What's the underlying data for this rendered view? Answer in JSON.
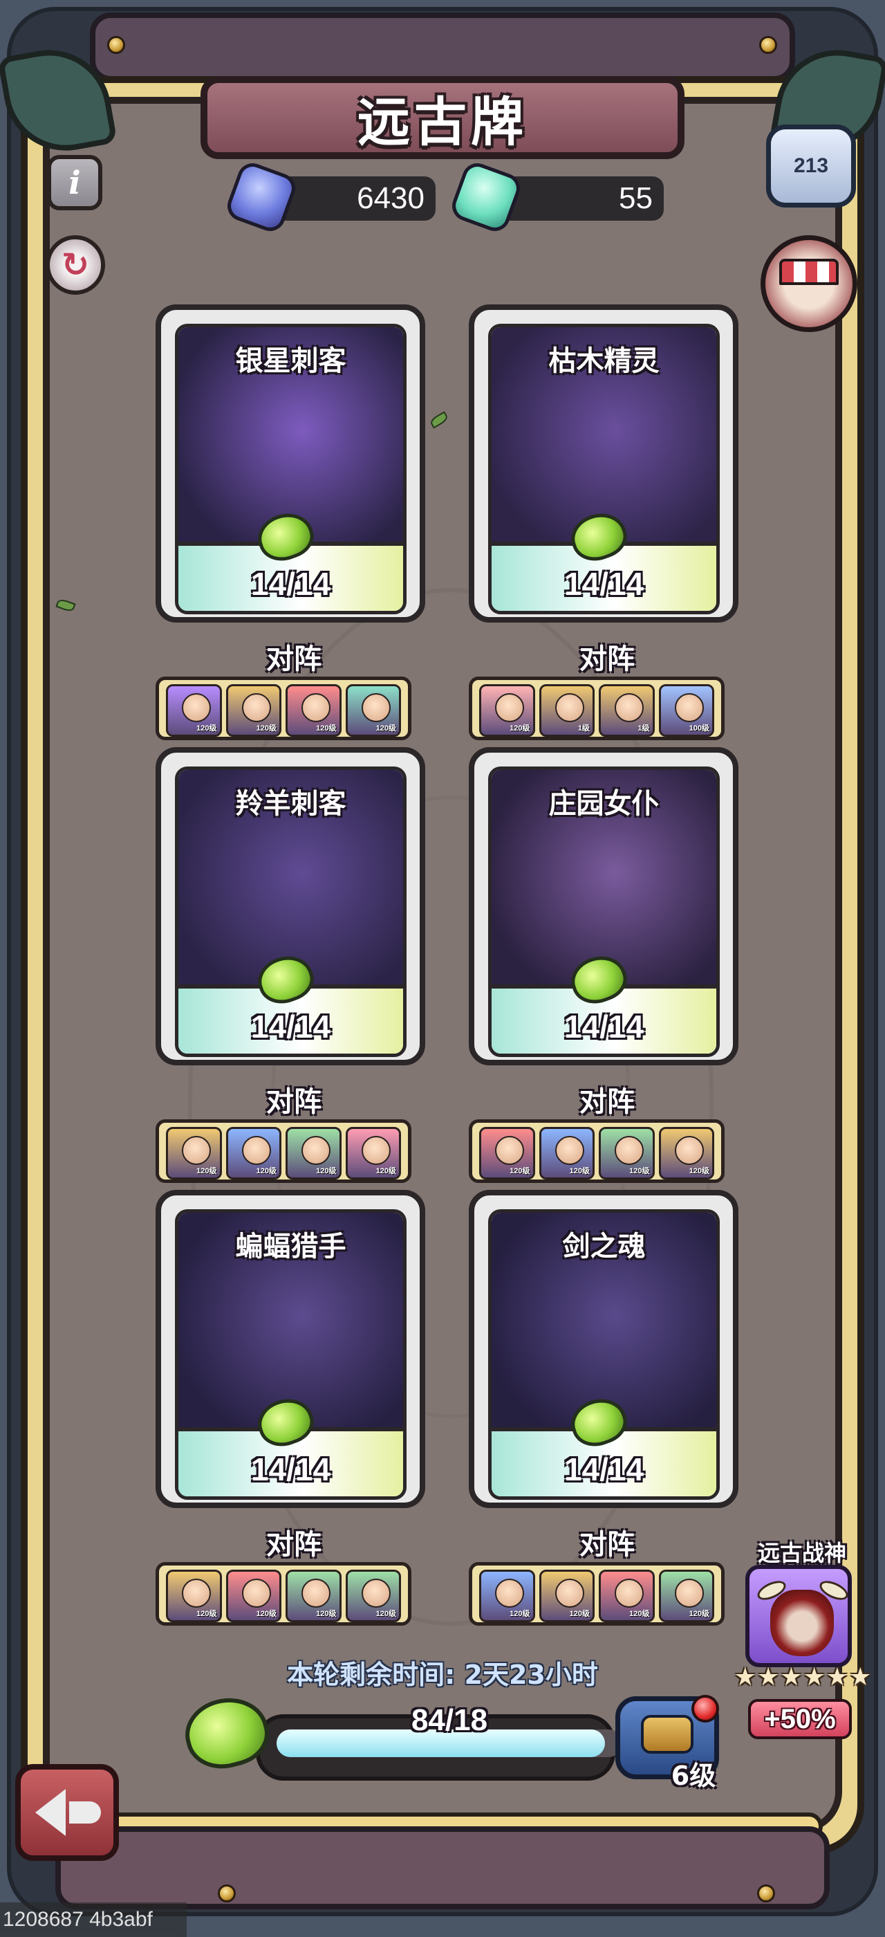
{
  "title": "远古牌",
  "currencies": {
    "blue": "6430",
    "green": "55"
  },
  "lineup_label": "对阵",
  "cards": [
    {
      "name": "银星刺客",
      "count": "14/14",
      "art_colors": [
        "#2a2346",
        "#7d5bbf"
      ],
      "lineup": [
        {
          "level": "120级",
          "color": "#b88dff"
        },
        {
          "level": "120级",
          "color": "#f0c971"
        },
        {
          "level": "120级",
          "color": "#ff8d8d"
        },
        {
          "level": "120级",
          "color": "#8de0c9"
        }
      ]
    },
    {
      "name": "枯木精灵",
      "count": "14/14",
      "art_colors": [
        "#2d2448",
        "#6a4f9e"
      ],
      "lineup": [
        {
          "level": "120级",
          "color": "#ffb4b4"
        },
        {
          "level": "1级",
          "color": "#f0c971"
        },
        {
          "level": "1级",
          "color": "#f0c971"
        },
        {
          "level": "100级",
          "color": "#a3c4ff"
        }
      ]
    },
    {
      "name": "羚羊刺客",
      "count": "14/14",
      "art_colors": [
        "#2c2448",
        "#5f4b94"
      ],
      "lineup": [
        {
          "level": "120级",
          "color": "#f0c971"
        },
        {
          "level": "120级",
          "color": "#8db6ff"
        },
        {
          "level": "120级",
          "color": "#9ee0a6"
        },
        {
          "level": "120级",
          "color": "#ff9db3"
        }
      ]
    },
    {
      "name": "庄园女仆",
      "count": "14/14",
      "art_colors": [
        "#2b2140",
        "#7a5b9d"
      ],
      "lineup": [
        {
          "level": "120级",
          "color": "#ff8d8d"
        },
        {
          "level": "120级",
          "color": "#8db6ff"
        },
        {
          "level": "120级",
          "color": "#9ee0a6"
        },
        {
          "level": "120级",
          "color": "#f0c971"
        }
      ]
    },
    {
      "name": "蝙蝠猎手",
      "count": "14/14",
      "art_colors": [
        "#262042",
        "#5d4b8f"
      ],
      "lineup": [
        {
          "level": "120级",
          "color": "#f0c971"
        },
        {
          "level": "120级",
          "color": "#ff8d8d"
        },
        {
          "level": "120级",
          "color": "#9ee0a6"
        },
        {
          "level": "120级",
          "color": "#9ee0a6"
        }
      ]
    },
    {
      "name": "剑之魂",
      "count": "14/14",
      "art_colors": [
        "#251f40",
        "#594a8c"
      ],
      "lineup": [
        {
          "level": "120级",
          "color": "#8db6ff"
        },
        {
          "level": "120级",
          "color": "#f0c971"
        },
        {
          "level": "120级",
          "color": "#ff8d8d"
        },
        {
          "level": "120级",
          "color": "#9ee0a6"
        }
      ]
    }
  ],
  "time_remaining": "本轮剩余时间: 2天23小时",
  "progress": {
    "text": "84/18",
    "fraction": 0.95
  },
  "level": "6级",
  "rank_icon_text": "213",
  "war_god": {
    "name": "远古战神",
    "stars": [
      "★",
      "★",
      "★",
      "★",
      "★",
      "★"
    ],
    "bonus": "+50%"
  },
  "build_id": "1208687 4b3abf",
  "icons": {
    "info": "i",
    "refresh": "↻"
  }
}
